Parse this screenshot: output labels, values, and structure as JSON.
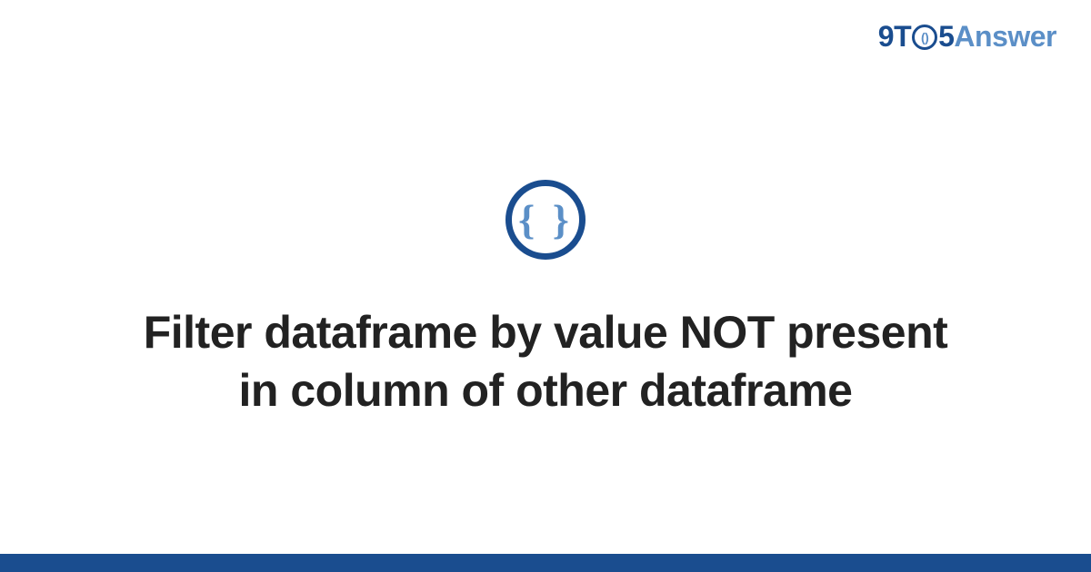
{
  "brand": {
    "nine": "9",
    "t": "T",
    "circle_inner": "()",
    "five": "5",
    "answer": "Answer"
  },
  "icon": {
    "braces": "{ }"
  },
  "title": "Filter dataframe by value NOT present in column of other dataframe",
  "colors": {
    "dark_blue": "#1a4d8f",
    "light_blue": "#5b8fc7",
    "text": "#222222",
    "background": "#ffffff"
  }
}
